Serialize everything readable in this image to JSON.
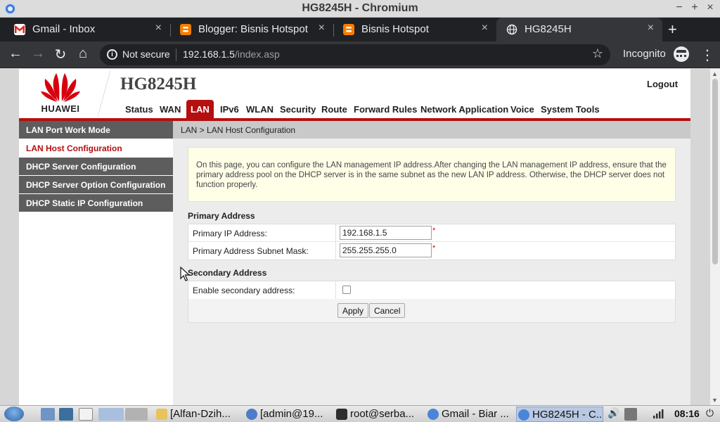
{
  "window": {
    "title": "HG8245H - Chromium",
    "minimize": "−",
    "maximize": "+",
    "close": "×"
  },
  "tabs": [
    {
      "label": "Gmail - Inbox",
      "icon": "gmail-icon",
      "active": false
    },
    {
      "label": "Blogger: Bisnis Hotspot",
      "icon": "blogger-icon",
      "active": false
    },
    {
      "label": "Bisnis Hotspot",
      "icon": "blogger-icon",
      "active": false
    },
    {
      "label": "HG8245H",
      "icon": "globe-icon",
      "active": true
    }
  ],
  "tab_close_glyph": "×",
  "new_tab_glyph": "+",
  "toolbar": {
    "back": "←",
    "forward": "→",
    "reload": "↻",
    "home": "⌂",
    "security_label": "Not secure",
    "url_host": "192.168.1.5",
    "url_path": "/index.asp",
    "bookmark_star": "☆",
    "profile_label": "Incognito",
    "menu": "⋮"
  },
  "router": {
    "brand": "HUAWEI",
    "model": "HG8245H",
    "logout": "Logout",
    "nav": [
      {
        "label": "Status",
        "active": false
      },
      {
        "label": "WAN",
        "active": false
      },
      {
        "label": "LAN",
        "active": true
      },
      {
        "label": "IPv6",
        "active": false
      },
      {
        "label": "WLAN",
        "active": false
      },
      {
        "label": "Security",
        "active": false
      },
      {
        "label": "Route",
        "active": false
      },
      {
        "label": "Forward Rules",
        "active": false
      },
      {
        "label": "Network Application",
        "active": false
      },
      {
        "label": "Voice",
        "active": false
      },
      {
        "label": "System Tools",
        "active": false
      }
    ],
    "sidebar": [
      {
        "label": "LAN Port Work Mode",
        "active": false
      },
      {
        "label": "LAN Host Configuration",
        "active": true
      },
      {
        "label": "DHCP Server Configuration",
        "active": false
      },
      {
        "label": "DHCP Server Option Configuration",
        "active": false
      },
      {
        "label": "DHCP Static IP Configuration",
        "active": false
      }
    ],
    "breadcrumb": "LAN > LAN Host Configuration",
    "notice": "On this page, you can configure the LAN management IP address.After changing the LAN management IP address, ensure that the primary address pool on the DHCP server is in the same subnet as the new LAN IP address. Otherwise, the DHCP server does not function properly.",
    "primary": {
      "title": "Primary Address",
      "ip_label": "Primary IP Address:",
      "ip_value": "192.168.1.5",
      "mask_label": "Primary Address Subnet Mask:",
      "mask_value": "255.255.255.0",
      "required_mark": "*"
    },
    "secondary": {
      "title": "Secondary Address",
      "enable_label": "Enable secondary address:",
      "enabled": false
    },
    "buttons": {
      "apply": "Apply",
      "cancel": "Cancel"
    }
  },
  "taskbar": {
    "tasks": [
      {
        "label": "[Alfan-Dzih...",
        "icon": "folder-icon",
        "active": false
      },
      {
        "label": "[admin@19...",
        "icon": "email-client-icon",
        "active": false
      },
      {
        "label": "root@serba...",
        "icon": "terminal-icon",
        "active": false
      },
      {
        "label": "Gmail - Biar ...",
        "icon": "chromium-icon",
        "active": false
      },
      {
        "label": "HG8245H - C...",
        "icon": "chromium-icon",
        "active": true
      }
    ],
    "clock": "08:16",
    "colors": {
      "accent": "#b50f0f"
    }
  }
}
